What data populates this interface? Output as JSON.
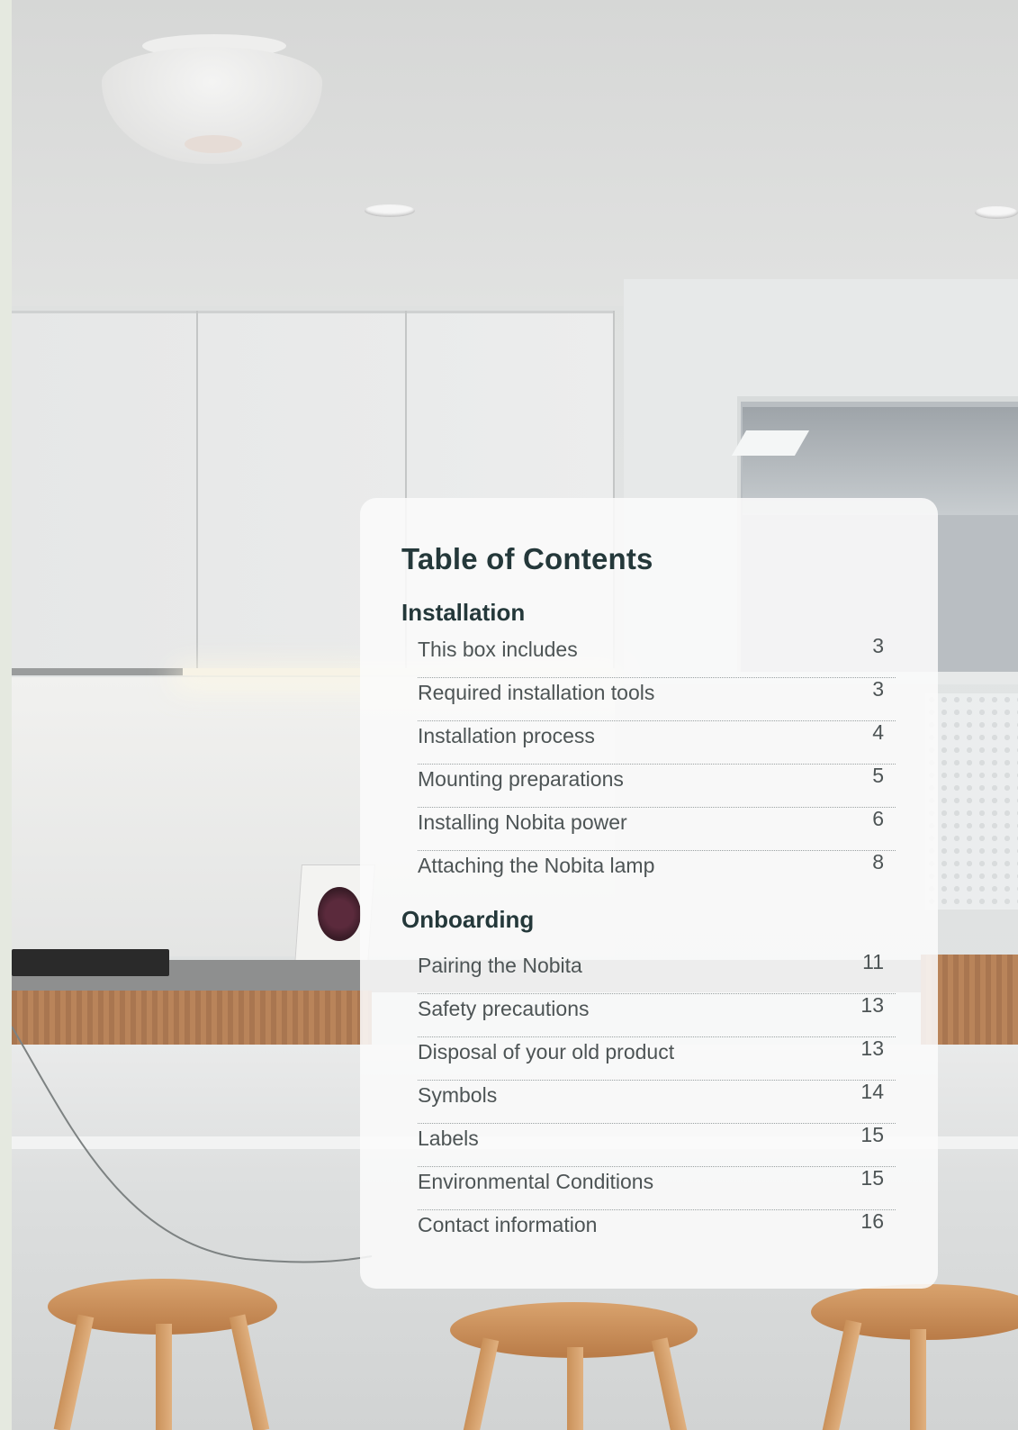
{
  "toc": {
    "title": "Table of Contents",
    "sections": [
      {
        "heading": "Installation",
        "entries": [
          {
            "label": "This box includes",
            "page": "3"
          },
          {
            "label": "Required installation tools",
            "page": "3"
          },
          {
            "label": "Installation process",
            "page": "4"
          },
          {
            "label": "Mounting preparations",
            "page": "5"
          },
          {
            "label": "Installing Nobita power",
            "page": "6"
          },
          {
            "label": "Attaching the Nobita lamp",
            "page": "8"
          }
        ]
      },
      {
        "heading": "Onboarding",
        "entries": [
          {
            "label": "Pairing the Nobita",
            "page": "11"
          },
          {
            "label": "Safety precautions",
            "page": "13"
          },
          {
            "label": "Disposal of your old product",
            "page": "13"
          },
          {
            "label": "Symbols",
            "page": "14"
          },
          {
            "label": "Labels",
            "page": "15"
          },
          {
            "label": "Environmental Conditions",
            "page": "15"
          },
          {
            "label": "Contact information",
            "page": "16"
          }
        ]
      }
    ]
  }
}
